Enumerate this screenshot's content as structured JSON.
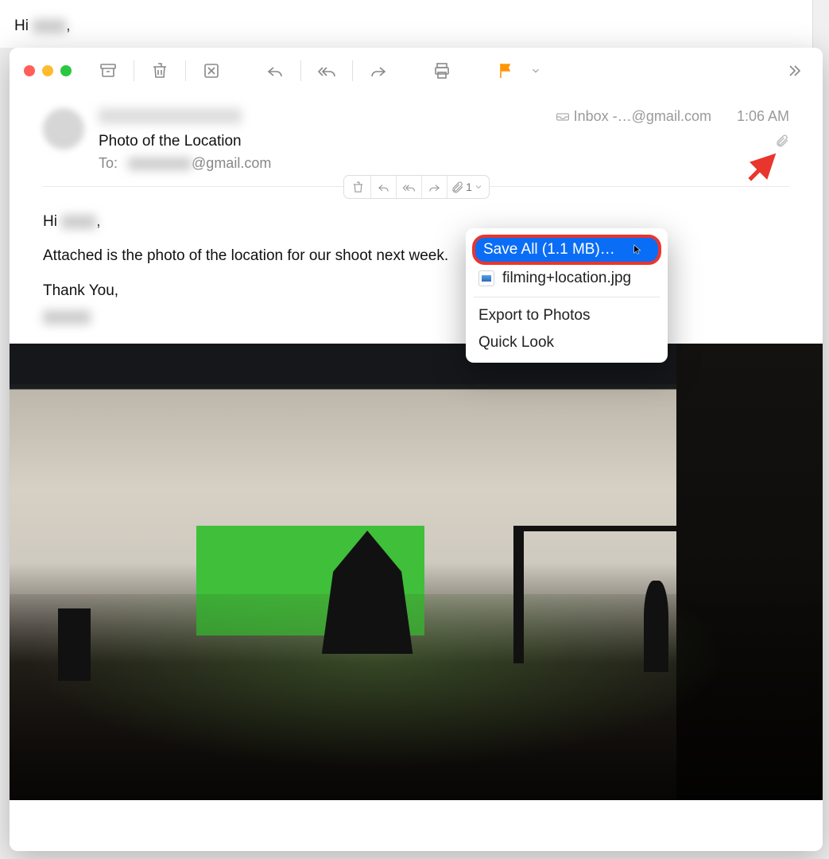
{
  "background_email": {
    "greeting_prefix": "Hi ",
    "greeting_suffix": ","
  },
  "toolbar": {
    "icons": {
      "archive": "archive-icon",
      "trash": "trash-icon",
      "junk": "junk-icon",
      "reply": "reply-icon",
      "reply_all": "reply-all-icon",
      "forward": "forward-icon",
      "print": "print-icon",
      "flag": "flag-icon",
      "flag_menu": "chevron-down-icon",
      "overflow": "chevron-double-right-icon"
    }
  },
  "header": {
    "subject": "Photo of the Location",
    "to_label": "To:",
    "to_email_suffix": "@gmail.com",
    "mailbox_label": "Inbox -…@gmail.com",
    "time": "1:06 AM"
  },
  "inline_toolbar": {
    "attachment_count": "1"
  },
  "body": {
    "greeting_prefix": "Hi ",
    "greeting_suffix": ",",
    "line1": "Attached is the photo of the location for our shoot next week.",
    "signoff": "Thank You,"
  },
  "attachment_menu": {
    "save_all": "Save All (1.1 MB)…",
    "file_name": "filming+location.jpg",
    "export": "Export to Photos",
    "quick_look": "Quick Look"
  }
}
